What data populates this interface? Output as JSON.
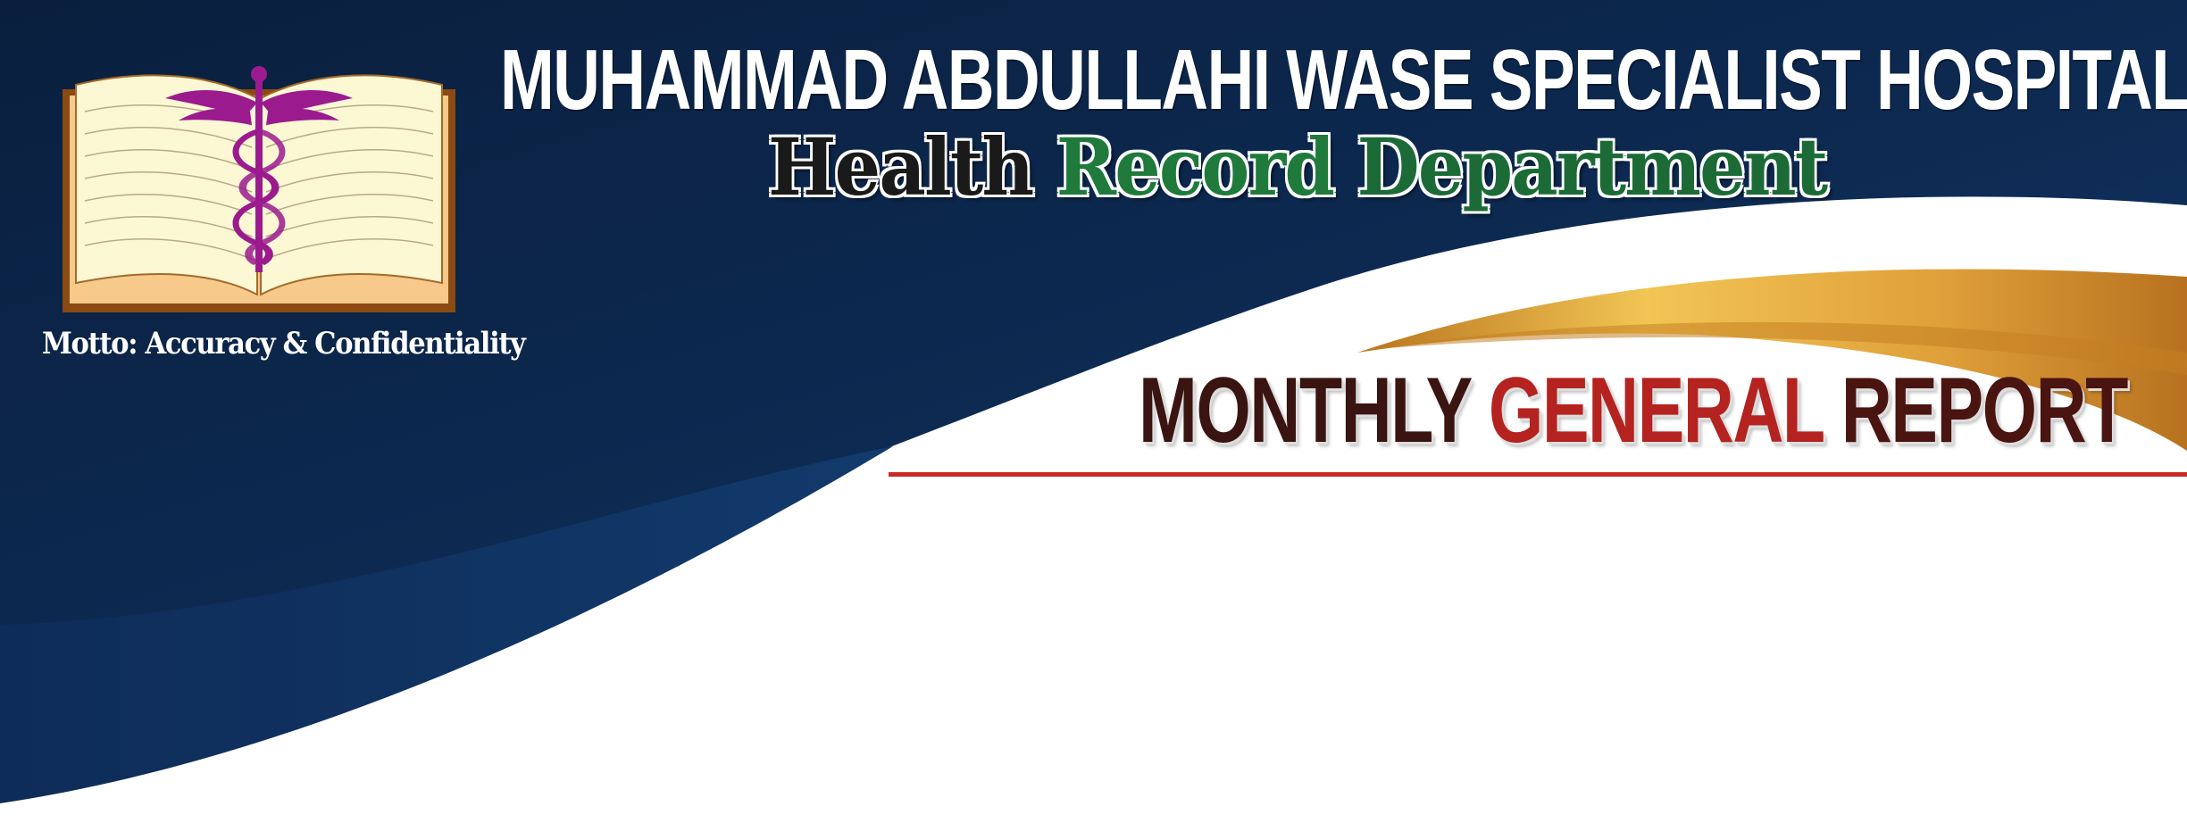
{
  "header": {
    "hospital_name": "MUHAMMAD ABDULLAHI WASE SPECIALIST HOSPITAL, KANO",
    "department": {
      "word1": "Health",
      "word2": "Record",
      "word3": "Department"
    }
  },
  "logo": {
    "icon": "caduceus-book-icon",
    "motto": "Motto: Accuracy & Confidentiality"
  },
  "report": {
    "word1": "MONTHLY",
    "word2": "GENERAL",
    "word3": "REPORT"
  },
  "colors": {
    "navy": "#0d2547",
    "gold": "#d9a23a",
    "red_rule": "#c92a25",
    "purple": "#9b1b8e",
    "green": "#1f7a3c"
  }
}
